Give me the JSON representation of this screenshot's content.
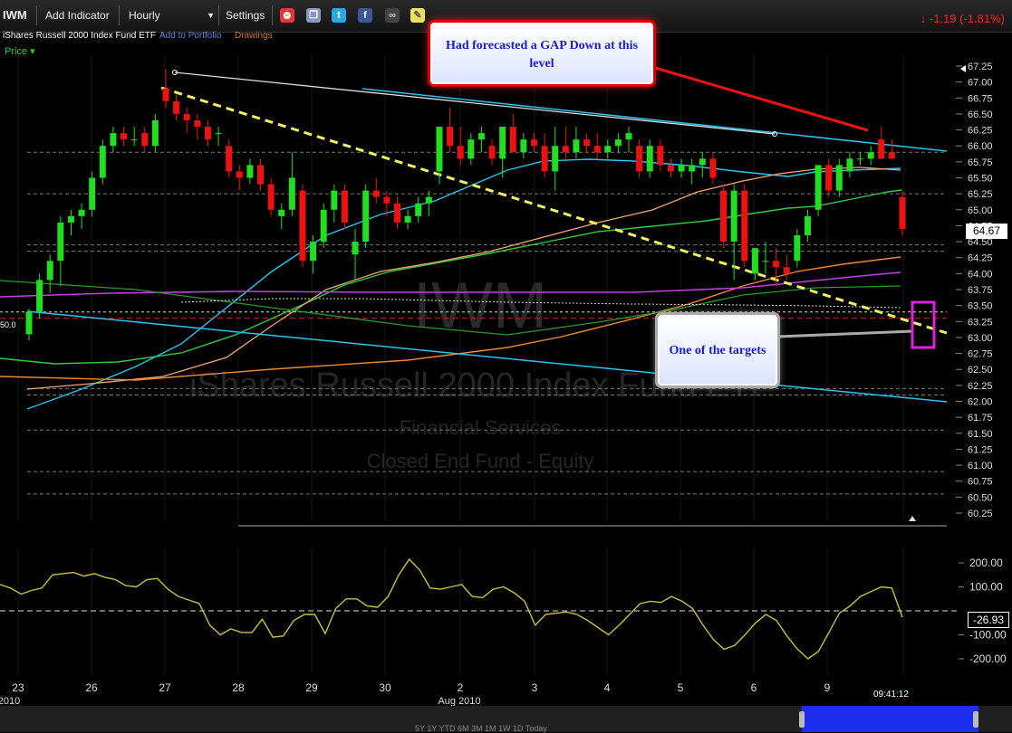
{
  "toolbar": {
    "symbol": "IWM",
    "add_indicator": "Add Indicator",
    "interval": "Hourly",
    "settings": "Settings",
    "change": "-1.19 (-1.81%)"
  },
  "subheader": {
    "name": "iShares Russell 2000 Index Fund ETF",
    "add_portfolio": "Add to Portfolio",
    "drawings": "Drawings"
  },
  "price_label": "Price",
  "watermark": {
    "symbol": "IWM",
    "name": "iShares Russell 2000 Index Fund ETF",
    "sector": "Financial Services",
    "type": "Closed End Fund - Equity"
  },
  "callouts": {
    "gap": "Had forecasted a GAP Down at this level",
    "targets": "One of the targets"
  },
  "last_price": "64.67",
  "osc_last": "-26.93",
  "time": "09:41:12",
  "range_buttons": "5Y 1Y YTD 6M 3M 1M 1W 1D Today",
  "left_axis_label": "50.0",
  "colors": {
    "up": "#22dd22",
    "down": "#ee1111",
    "cyan": "#29c4f0",
    "orange": "#f08a2a",
    "green_ma": "#2ecc40",
    "magenta": "#c040e0",
    "yellow_trend": "#f0f060",
    "osc": "#c8c040"
  },
  "chart_data": {
    "type": "candlestick",
    "y_ticks": [
      "67.25",
      "67.00",
      "66.75",
      "66.50",
      "66.25",
      "66.00",
      "65.75",
      "65.50",
      "65.25",
      "65.00",
      "64.75",
      "64.50",
      "64.25",
      "64.00",
      "63.75",
      "63.50",
      "63.25",
      "63.00",
      "62.75",
      "62.50",
      "62.25",
      "62.00",
      "61.75",
      "61.50",
      "61.25",
      "61.00",
      "60.75",
      "60.50",
      "60.25"
    ],
    "ylim": [
      60.25,
      67.25
    ],
    "x_labels": [
      "23",
      "26",
      "27",
      "28",
      "29",
      "30",
      "2",
      "3",
      "4",
      "5",
      "6",
      "9"
    ],
    "month_labels": [
      "2010",
      "Aug 2010"
    ],
    "osc_ticks": [
      "200.00",
      "100.00",
      "-100.00",
      "-200.00"
    ],
    "osc_ylim": [
      -200,
      200
    ],
    "candles": [
      [
        63.05,
        63.45,
        62.95,
        63.4
      ],
      [
        63.4,
        64.0,
        63.3,
        63.9
      ],
      [
        63.9,
        64.3,
        63.7,
        64.2
      ],
      [
        64.2,
        64.9,
        63.8,
        64.8
      ],
      [
        64.8,
        65.0,
        64.6,
        64.9
      ],
      [
        64.9,
        65.1,
        64.7,
        65.0
      ],
      [
        65.0,
        65.6,
        64.9,
        65.5
      ],
      [
        65.5,
        66.1,
        65.4,
        66.0
      ],
      [
        66.0,
        66.3,
        65.9,
        66.2
      ],
      [
        66.2,
        66.3,
        66.0,
        66.1
      ],
      [
        66.1,
        66.3,
        66.0,
        66.1
      ],
      [
        66.2,
        66.3,
        65.9,
        66.0
      ],
      [
        66.0,
        66.5,
        65.9,
        66.4
      ],
      [
        66.9,
        67.2,
        66.6,
        66.7
      ],
      [
        66.7,
        66.8,
        66.4,
        66.5
      ],
      [
        66.5,
        66.6,
        66.2,
        66.4
      ],
      [
        66.4,
        66.5,
        66.1,
        66.3
      ],
      [
        66.3,
        66.4,
        66.0,
        66.1
      ],
      [
        66.2,
        66.3,
        66.0,
        66.2
      ],
      [
        66.0,
        66.1,
        65.5,
        65.6
      ],
      [
        65.6,
        65.7,
        65.3,
        65.5
      ],
      [
        65.5,
        65.8,
        65.4,
        65.7
      ],
      [
        65.7,
        65.8,
        65.3,
        65.4
      ],
      [
        65.4,
        65.5,
        64.9,
        65.0
      ],
      [
        64.9,
        65.1,
        64.7,
        65.0
      ],
      [
        65.0,
        65.9,
        64.9,
        65.5
      ],
      [
        65.3,
        65.4,
        64.1,
        64.2
      ],
      [
        64.2,
        64.6,
        64.0,
        64.5
      ],
      [
        64.5,
        65.1,
        64.4,
        65.0
      ],
      [
        65.0,
        65.4,
        64.8,
        65.3
      ],
      [
        65.3,
        65.4,
        64.7,
        64.8
      ],
      [
        64.3,
        64.7,
        63.9,
        64.5
      ],
      [
        64.5,
        65.4,
        64.4,
        65.3
      ],
      [
        65.3,
        65.5,
        65.1,
        65.2
      ],
      [
        65.2,
        65.3,
        64.9,
        65.1
      ],
      [
        65.1,
        65.2,
        64.7,
        64.8
      ],
      [
        64.8,
        65.0,
        64.7,
        64.9
      ],
      [
        64.9,
        65.2,
        64.8,
        65.1
      ],
      [
        65.1,
        65.3,
        64.9,
        65.2
      ],
      [
        65.6,
        66.2,
        65.4,
        66.3
      ],
      [
        66.3,
        66.6,
        65.9,
        66.0
      ],
      [
        66.0,
        66.3,
        65.7,
        65.8
      ],
      [
        65.8,
        66.2,
        65.7,
        66.1
      ],
      [
        66.1,
        66.3,
        65.9,
        66.2
      ],
      [
        66.0,
        66.1,
        65.7,
        65.8
      ],
      [
        65.8,
        66.2,
        65.5,
        66.3
      ],
      [
        66.3,
        66.5,
        65.9,
        65.9
      ],
      [
        65.9,
        66.2,
        65.8,
        66.1
      ],
      [
        66.1,
        66.2,
        65.9,
        66.0
      ],
      [
        66.0,
        66.2,
        65.5,
        65.6
      ],
      [
        65.6,
        66.3,
        65.3,
        66.0
      ],
      [
        66.0,
        66.3,
        65.8,
        65.9
      ],
      [
        65.9,
        66.3,
        65.8,
        66.1
      ],
      [
        66.1,
        66.2,
        65.9,
        66.0
      ],
      [
        66.0,
        66.2,
        65.8,
        65.9
      ],
      [
        65.9,
        66.1,
        65.8,
        66.0
      ],
      [
        66.0,
        66.2,
        65.9,
        66.1
      ],
      [
        66.1,
        66.3,
        65.9,
        66.2
      ],
      [
        66.0,
        66.1,
        65.5,
        65.6
      ],
      [
        65.6,
        66.1,
        65.5,
        66.0
      ],
      [
        66.0,
        66.1,
        65.6,
        65.7
      ],
      [
        65.7,
        65.8,
        65.5,
        65.6
      ],
      [
        65.6,
        65.8,
        65.5,
        65.7
      ],
      [
        65.6,
        65.8,
        65.4,
        65.7
      ],
      [
        65.7,
        65.9,
        65.5,
        65.8
      ],
      [
        65.8,
        65.9,
        65.4,
        65.5
      ],
      [
        65.3,
        65.4,
        64.4,
        64.5
      ],
      [
        64.5,
        65.4,
        63.9,
        65.3
      ],
      [
        65.3,
        65.4,
        64.1,
        64.2
      ],
      [
        64.0,
        64.4,
        63.9,
        64.4
      ],
      [
        64.2,
        64.5,
        64.0,
        64.2
      ],
      [
        64.2,
        64.4,
        63.8,
        64.1
      ],
      [
        64.1,
        64.3,
        63.9,
        64.0
      ],
      [
        64.2,
        64.7,
        64.1,
        64.6
      ],
      [
        64.6,
        65.0,
        64.5,
        64.9
      ],
      [
        65.0,
        65.3,
        64.9,
        65.7
      ],
      [
        65.7,
        65.8,
        65.2,
        65.3
      ],
      [
        65.3,
        65.8,
        65.2,
        65.7
      ],
      [
        65.6,
        65.9,
        65.5,
        65.8
      ],
      [
        65.8,
        65.9,
        65.7,
        65.8
      ],
      [
        65.8,
        66.0,
        65.7,
        65.9
      ],
      [
        66.1,
        66.3,
        65.8,
        65.8
      ],
      [
        65.9,
        66.1,
        65.8,
        65.8
      ],
      [
        65.2,
        65.3,
        64.6,
        64.7
      ]
    ],
    "oscillator": [
      110,
      95,
      70,
      85,
      95,
      150,
      155,
      160,
      145,
      155,
      140,
      130,
      105,
      100,
      130,
      135,
      90,
      60,
      45,
      30,
      -60,
      -100,
      -75,
      -90,
      -90,
      -35,
      -110,
      -105,
      -40,
      -15,
      -15,
      -95,
      10,
      50,
      50,
      20,
      15,
      60,
      150,
      215,
      170,
      95,
      90,
      100,
      110,
      60,
      55,
      90,
      100,
      75,
      40,
      -60,
      -15,
      -10,
      -5,
      -15,
      -40,
      -70,
      -100,
      -60,
      -15,
      30,
      40,
      35,
      60,
      40,
      10,
      -60,
      -120,
      -160,
      -145,
      -100,
      -50,
      -15,
      -40,
      -105,
      -160,
      -200,
      -170,
      -90,
      -10,
      20,
      60,
      80,
      100,
      95,
      -26.93
    ]
  }
}
